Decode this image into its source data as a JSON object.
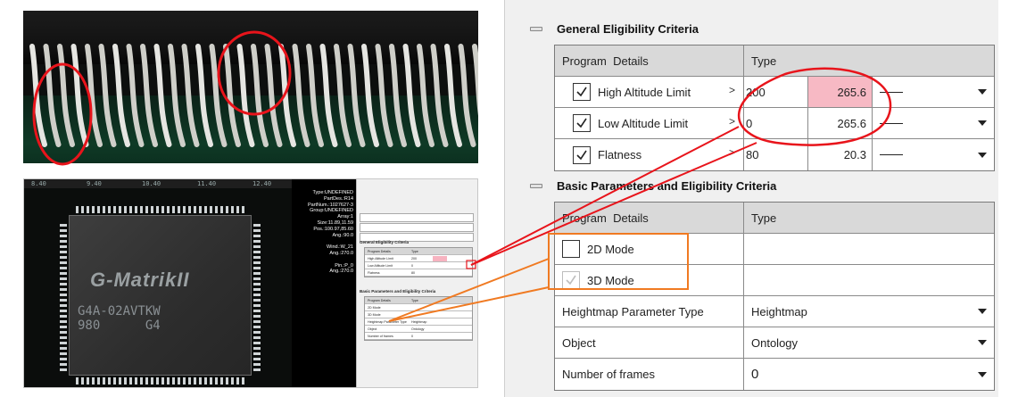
{
  "colors": {
    "callout_red": "#e8141b",
    "callout_orange": "#f07a22",
    "highlight_pink": "#f7b9c4",
    "panel_bg": "#f0f0f0",
    "header_bg": "#d9d9d9"
  },
  "mini_screenshot": {
    "ruler_labels": [
      "8.40",
      "9.40",
      "10.40",
      "11.40",
      "12.40"
    ],
    "chip_logo": "G-MatrikII",
    "chip_part": [
      "G4A-02AVTKW",
      "980      G4"
    ],
    "info_lines": [
      "Type:UNDEFINED",
      "PartDes.:R14",
      "PartNum.:1027627-3",
      "Group:UNDEFINED",
      "Array:1",
      "Size:11.89,11.59",
      "Pos.:100.97,85.60",
      "Ang.:90.0",
      "",
      "Wind.:W_21",
      "Ang.:270.0",
      "",
      "Pin.:P_0",
      "Ang.:270.0"
    ],
    "general_title": "General Eligibility Criteria",
    "basic_title": "Basic Parameters and Eligibility Criteria",
    "header_name": "Program Details",
    "header_type": "Type",
    "rows_general": [
      {
        "label": "High Altitude Limit",
        "min": "200",
        "max": "265.6"
      },
      {
        "label": "Low Altitude Limit",
        "min": "0",
        "max": "265.6"
      },
      {
        "label": "Flatness",
        "min": "80",
        "max": "20.3"
      }
    ],
    "rows_basic": [
      "2D Mode",
      "3D Mode",
      "Heightmap Parameter Type",
      "Object",
      "Number of frames"
    ],
    "basic_values": [
      "",
      "",
      "Heightmap",
      "Ontology",
      "0"
    ]
  },
  "panel": {
    "general": {
      "title": "General Eligibility Criteria",
      "header_name": "Program  Details",
      "header_type": "Type",
      "rows": [
        {
          "label": "High Altitude Limit",
          "checked": true,
          "min": "200",
          "max": "265.6",
          "max_highlight": true
        },
        {
          "label": "Low Altitude Limit",
          "checked": true,
          "min": "0",
          "max": "265.6",
          "max_highlight": false
        },
        {
          "label": "Flatness",
          "checked": true,
          "min": "80",
          "max": "20.3",
          "max_highlight": false
        }
      ],
      "arrow_glyph": ">"
    },
    "basic": {
      "title": "Basic Parameters and Eligibility Criteria",
      "header_name": "Program  Details",
      "header_type": "Type",
      "mode_2d": "2D Mode",
      "mode_3d": "3D Mode",
      "heightmap_label": "Heightmap Parameter Type",
      "heightmap_value": "Heightmap",
      "object_label": "Object",
      "object_value": "Ontology",
      "frames_label": "Number of frames",
      "frames_value": "0"
    }
  }
}
